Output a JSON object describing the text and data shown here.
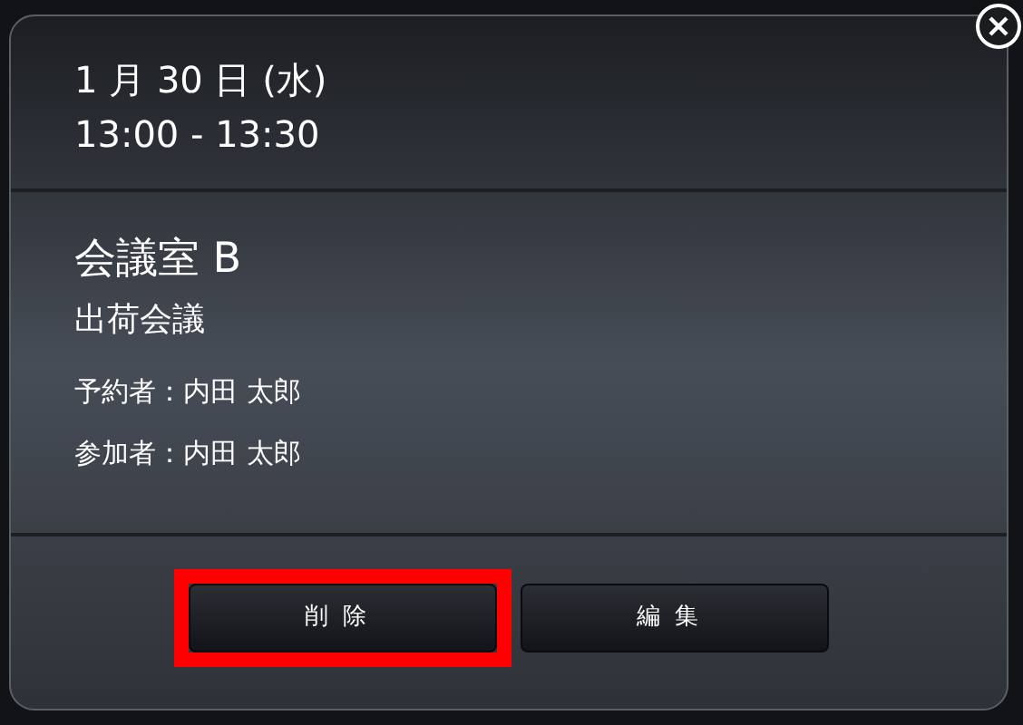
{
  "dialog": {
    "date": "1 月 30 日 (水)",
    "time": "13:00 - 13:30",
    "room": "会議室 B",
    "title": "出荷会議",
    "details": [
      {
        "label": "予約者：",
        "value": "内田 太郎"
      },
      {
        "label": "参加者：",
        "value": "内田 太郎"
      }
    ],
    "buttons": [
      {
        "label": "削除",
        "highlighted": true
      },
      {
        "label": "編集",
        "highlighted": false
      }
    ]
  }
}
